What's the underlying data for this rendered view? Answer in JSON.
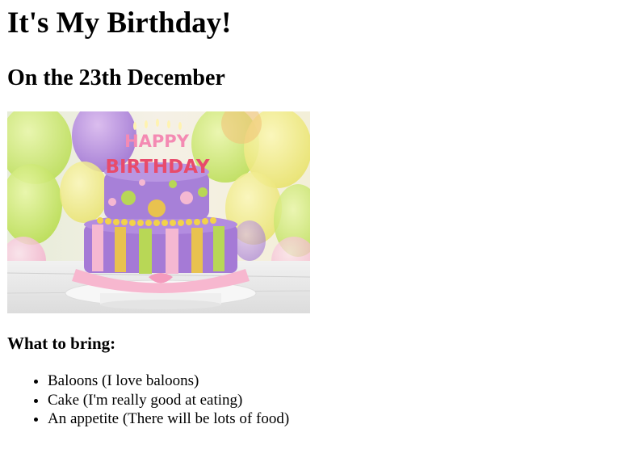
{
  "heading": "It's My Birthday!",
  "subheading": "On the 23th December",
  "image": {
    "candle_text_line1": "HAPPY",
    "candle_text_line2": "BIRTHDAY"
  },
  "bring_heading": "What to bring:",
  "bring_items": [
    "Baloons (I love baloons)",
    "Cake (I'm really good at eating)",
    "An appetite (There will be lots of food)"
  ]
}
